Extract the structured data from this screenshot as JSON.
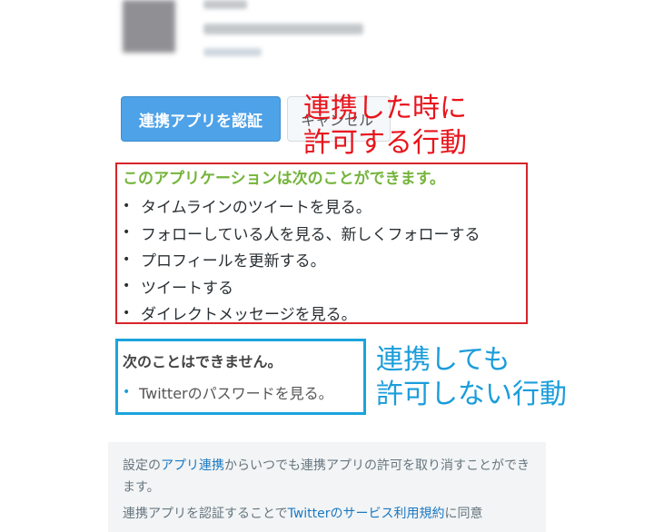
{
  "buttons": {
    "authorize_label": "連携アプリを認証",
    "cancel_label": "キャンセル"
  },
  "annotations": {
    "allowed_line1": "連携した時に",
    "allowed_line2": "許可する行動",
    "denied_line1": "連携しても",
    "denied_line2": "許可しない行動",
    "allowed_color": "#e8141c",
    "denied_color": "#1a9ddb"
  },
  "permissions": {
    "title": "このアプリケーションは次のことができます。",
    "title_color": "#74b43b",
    "items": [
      "タイムラインのツイートを見る。",
      "フォローしている人を見る、新しくフォローする",
      "プロフィールを更新する。",
      "ツイートする",
      "ダイレクトメッセージを見る。"
    ]
  },
  "restrictions": {
    "title": "次のことはできません。",
    "items": [
      "Twitterのパスワードを見る。"
    ]
  },
  "footer": {
    "line1_pre": "設定の",
    "line1_link": "アプリ連携",
    "line1_post": "からいつでも連携アプリの許可を取り消すことができます。",
    "line2_pre": "連携アプリを認証することで",
    "line2_link": "Twitterのサービス利用規約",
    "line2_post": "に同意"
  },
  "colors": {
    "primary_button": "#4ea2e8",
    "link": "#1b78c2"
  }
}
